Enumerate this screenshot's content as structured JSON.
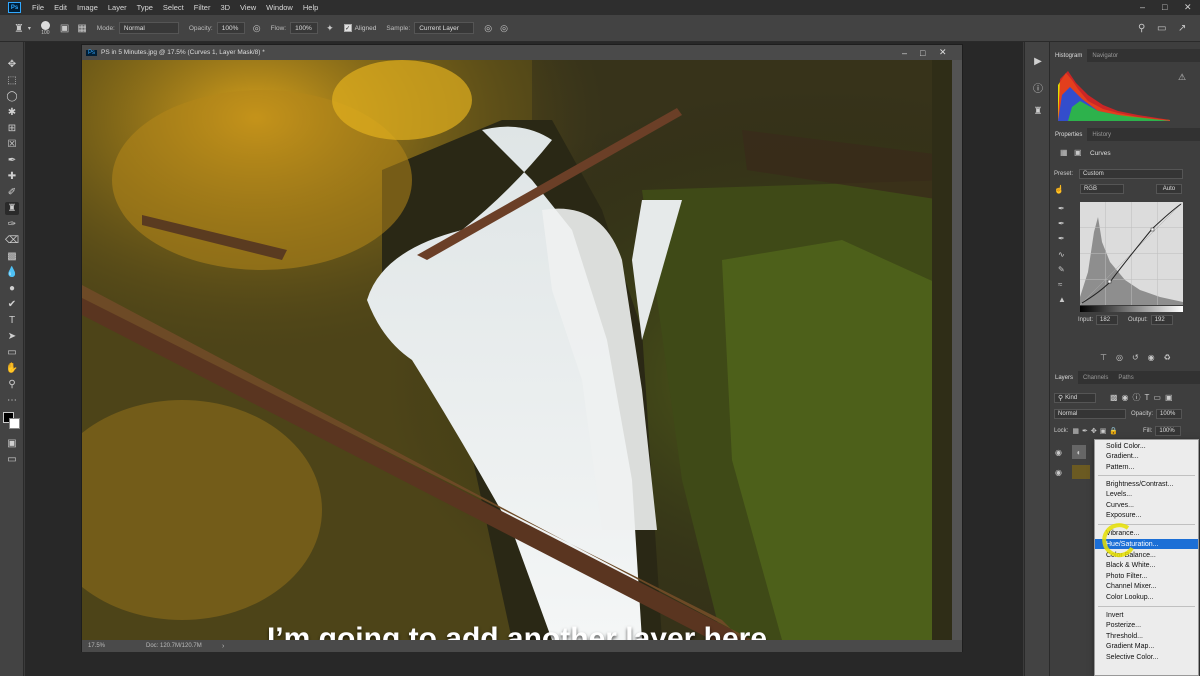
{
  "menubar": {
    "logo": "Ps",
    "items": [
      "File",
      "Edit",
      "Image",
      "Layer",
      "Type",
      "Select",
      "Filter",
      "3D",
      "View",
      "Window",
      "Help"
    ]
  },
  "options": {
    "brush_size": "100",
    "mode_label": "Mode:",
    "mode_value": "Normal",
    "opacity_label": "Opacity:",
    "opacity_value": "100%",
    "flow_label": "Flow:",
    "flow_value": "100%",
    "aligned_label": "Aligned",
    "sample_label": "Sample:",
    "sample_value": "Current Layer"
  },
  "document": {
    "title": "PS in 5 Minutes.jpg @ 17.5% (Curves 1, Layer Mask/8) *",
    "zoom": "17.5%",
    "doc_size": "Doc: 120.7M/120.7M",
    "subtitle": "I’m going to add another layer here"
  },
  "panels": {
    "histogram_tab": "Histogram",
    "navigator_tab": "Navigator",
    "properties_tab": "Properties",
    "history_tab": "History",
    "curves_title": "Curves",
    "preset_label": "Preset:",
    "preset_value": "Custom",
    "channel_value": "RGB",
    "auto_label": "Auto",
    "input_label": "Input:",
    "input_value": "182",
    "output_label": "Output:",
    "output_value": "192",
    "layers_tab": "Layers",
    "channels_tab": "Channels",
    "paths_tab": "Paths",
    "kind_label": "Kind",
    "blend_value": "Normal",
    "opacity_label": "Opacity:",
    "opacity_value": "100%",
    "lock_label": "Lock:",
    "fill_label": "Fill:",
    "fill_value": "100%"
  },
  "dropdown": {
    "items": [
      "Solid Color...",
      "Gradient...",
      "Pattern...",
      "Brightness/Contrast...",
      "Levels...",
      "Curves...",
      "Exposure...",
      "Vibrance...",
      "Hue/Saturation...",
      "Color Balance...",
      "Black & White...",
      "Photo Filter...",
      "Channel Mixer...",
      "Color Lookup...",
      "Invert",
      "Posterize...",
      "Threshold...",
      "Gradient Map...",
      "Selective Color..."
    ],
    "highlighted": "Hue/Saturation..."
  }
}
